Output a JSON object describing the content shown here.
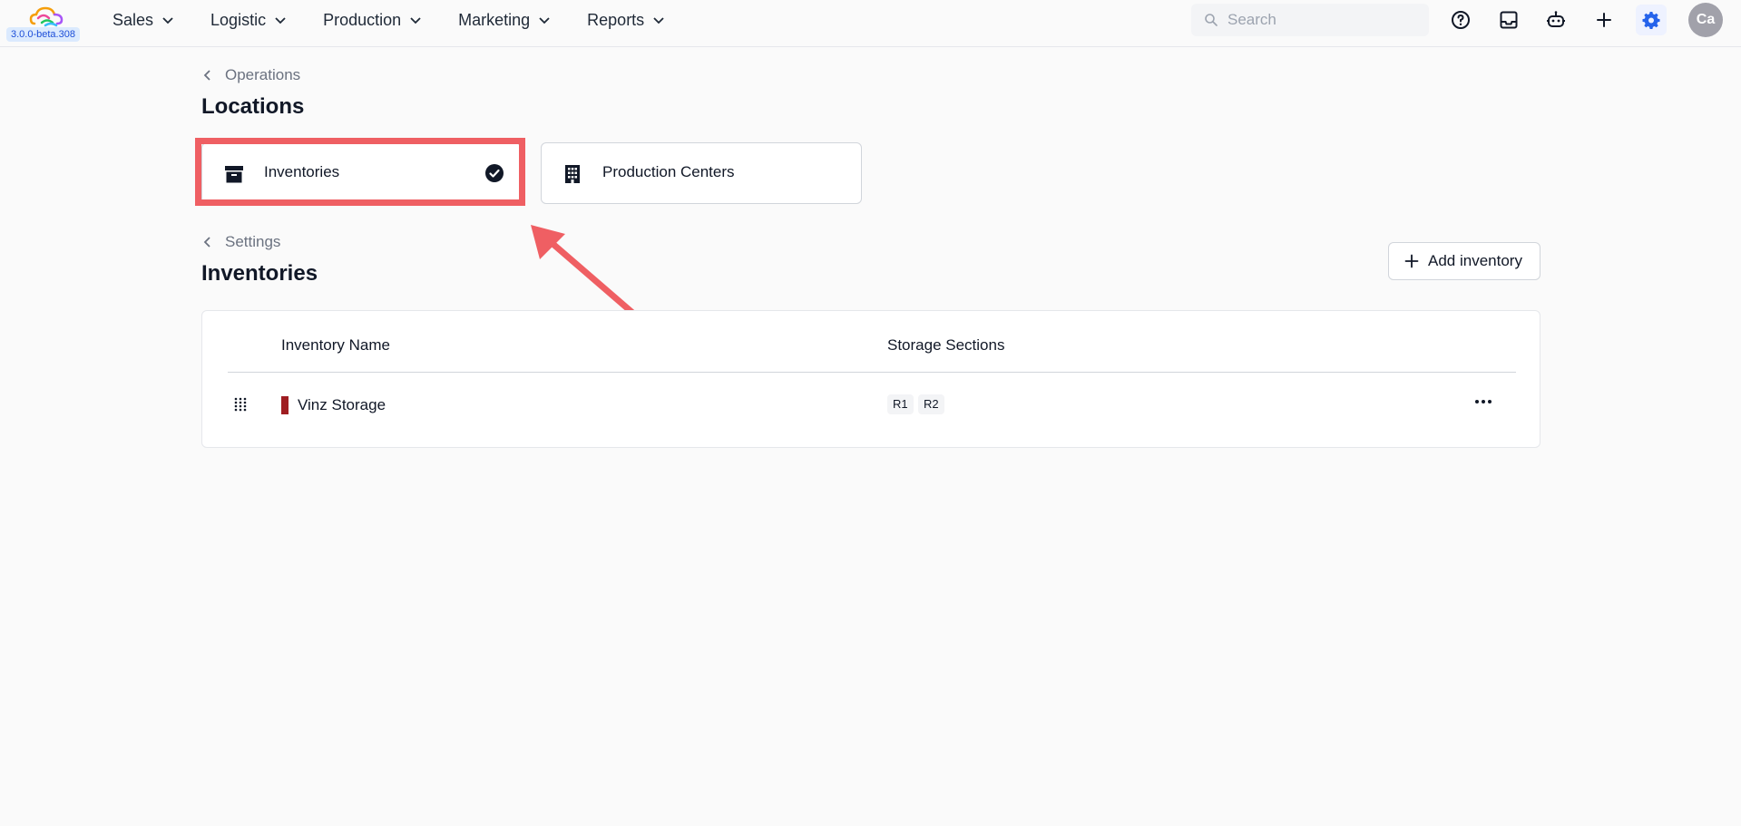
{
  "app": {
    "version": "3.0.0-beta.308"
  },
  "nav": {
    "items": [
      "Sales",
      "Logistic",
      "Production",
      "Marketing",
      "Reports"
    ]
  },
  "search": {
    "placeholder": "Search"
  },
  "user": {
    "initials": "Ca"
  },
  "locations": {
    "breadcrumb": "Operations",
    "title": "Locations",
    "tabs": [
      {
        "label": "Inventories",
        "selected": true
      },
      {
        "label": "Production Centers",
        "selected": false
      }
    ]
  },
  "inventories": {
    "breadcrumb": "Settings",
    "title": "Inventories",
    "add_button": "Add inventory",
    "columns": [
      "Inventory Name",
      "Storage Sections"
    ],
    "rows": [
      {
        "name": "Vinz Storage",
        "color": "#9f1d21",
        "sections": [
          "R1",
          "R2"
        ]
      }
    ]
  },
  "colors": {
    "accent": "#2563eb",
    "highlight": "#ef5f63"
  }
}
